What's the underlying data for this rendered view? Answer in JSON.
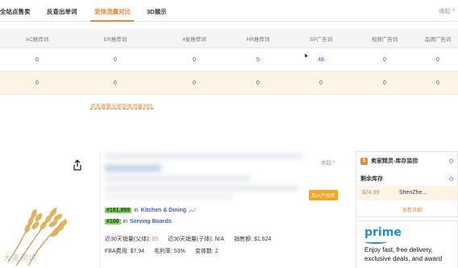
{
  "tabs": {
    "items": [
      {
        "label": "全站点售卖"
      },
      {
        "label": "反查出单词"
      },
      {
        "label": "变体流量对比"
      },
      {
        "label": "3D展示"
      }
    ],
    "collapse": "收起 ^"
  },
  "table": {
    "headers": [
      "AC推荐词",
      "ER推荐词",
      "4星推荐词",
      "HR推荐词",
      "SP广告词",
      "视频广告词",
      "品牌广告词"
    ],
    "rows": [
      [
        "0",
        "0",
        "0",
        "5",
        "48",
        "0",
        "0"
      ],
      [
        "0",
        "0",
        "0",
        "0",
        "0",
        "0",
        "0"
      ]
    ],
    "view_all": "点击查看全部变体流量对比"
  },
  "card": {
    "collapse": "收起 ^",
    "add_product": "加入产品库",
    "rank1": {
      "rank": "#181,859",
      "in": "in",
      "category": "Kitchen & Dining"
    },
    "rank2": {
      "rank": "#100",
      "in": "in",
      "category": "Serving Boards"
    },
    "stats1": {
      "parent_sales_label": "近30天销量(父体):",
      "parent_sales_value": "65",
      "child_sales": "近30天销量(子体): N/A",
      "revenue": "销售额: $1,624"
    },
    "stats2": {
      "fba": "FBA费用: $7.94",
      "margin": "毛利率: 53%",
      "variants": "变体数: 2"
    }
  },
  "side_panel": {
    "title": "卖家精灵-库存监控",
    "subtitle": "剩余库存",
    "price": "$24.99",
    "location": "ShenZhe...",
    "detail_link": "查看详细"
  },
  "prime": {
    "logo": "prime",
    "text": "Enjoy fast, free delivery, exclusive deals, and award"
  },
  "watermark": "大麦跨境",
  "colors": {
    "accent": "#e8882f",
    "link": "#3b5fc6",
    "highlight_row": "#fdf4e6",
    "rank_badge": "#7ed55c"
  }
}
